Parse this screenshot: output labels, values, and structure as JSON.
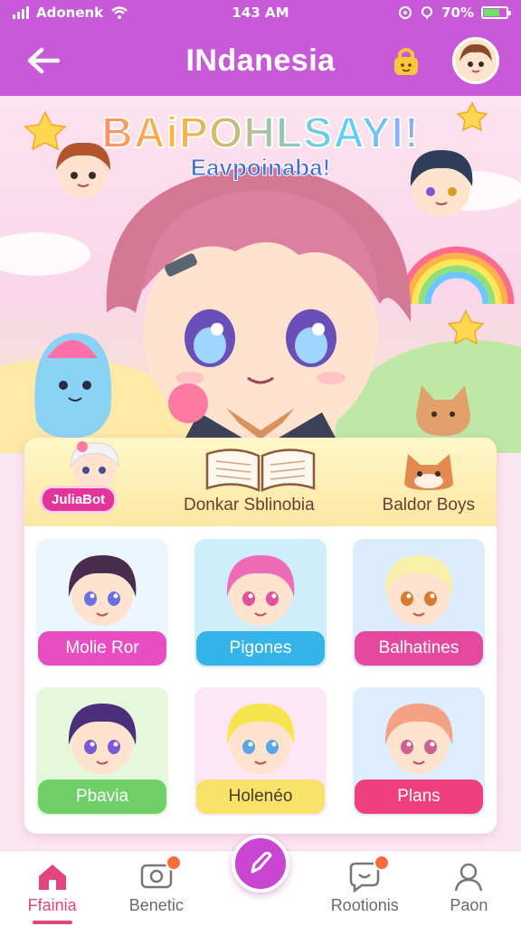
{
  "status_bar": {
    "carrier": "Adonenk",
    "time": "143 AM",
    "battery": "70%",
    "battery_level": 0.7
  },
  "header": {
    "title": "INdanesia"
  },
  "hero": {
    "title": "BAiPOHLSAYI!",
    "subtitle": "Eavpoinaba!"
  },
  "categories": [
    {
      "label": "JuliaBot"
    },
    {
      "label": "Donkar Sblinobia"
    },
    {
      "label": "Baldor Boys"
    }
  ],
  "tiles": [
    {
      "label": "Molie Ror",
      "hair": "#4a2c4f",
      "skin": "#ffe3cf",
      "eyes": "#6b6fe0"
    },
    {
      "label": "Pigones",
      "hair": "#f06bb5",
      "skin": "#ffe3cf",
      "eyes": "#e0529c"
    },
    {
      "label": "Balhatines",
      "hair": "#f8f0a8",
      "skin": "#ffe3cf",
      "eyes": "#d77c2e"
    },
    {
      "label": "Pbavia",
      "hair": "#4b2f7b",
      "skin": "#ffe3cf",
      "eyes": "#7a58d8"
    },
    {
      "label": "Holenéo",
      "hair": "#f6e54f",
      "skin": "#ffe3cf",
      "eyes": "#5aa7e8"
    },
    {
      "label": "Plans",
      "hair": "#f5a184",
      "skin": "#ffe3cf",
      "eyes": "#c9628e"
    }
  ],
  "bottom_nav": [
    {
      "label": "Ffainia",
      "icon": "home-icon"
    },
    {
      "label": "Benetic",
      "icon": "chat-icon"
    },
    {
      "label": "Rootionis",
      "icon": "message-icon"
    },
    {
      "label": "Paon",
      "icon": "profile-icon"
    }
  ],
  "colors": {
    "brand": "#c85ad9",
    "accent": "#e0457e",
    "fab": "#c945d2"
  }
}
